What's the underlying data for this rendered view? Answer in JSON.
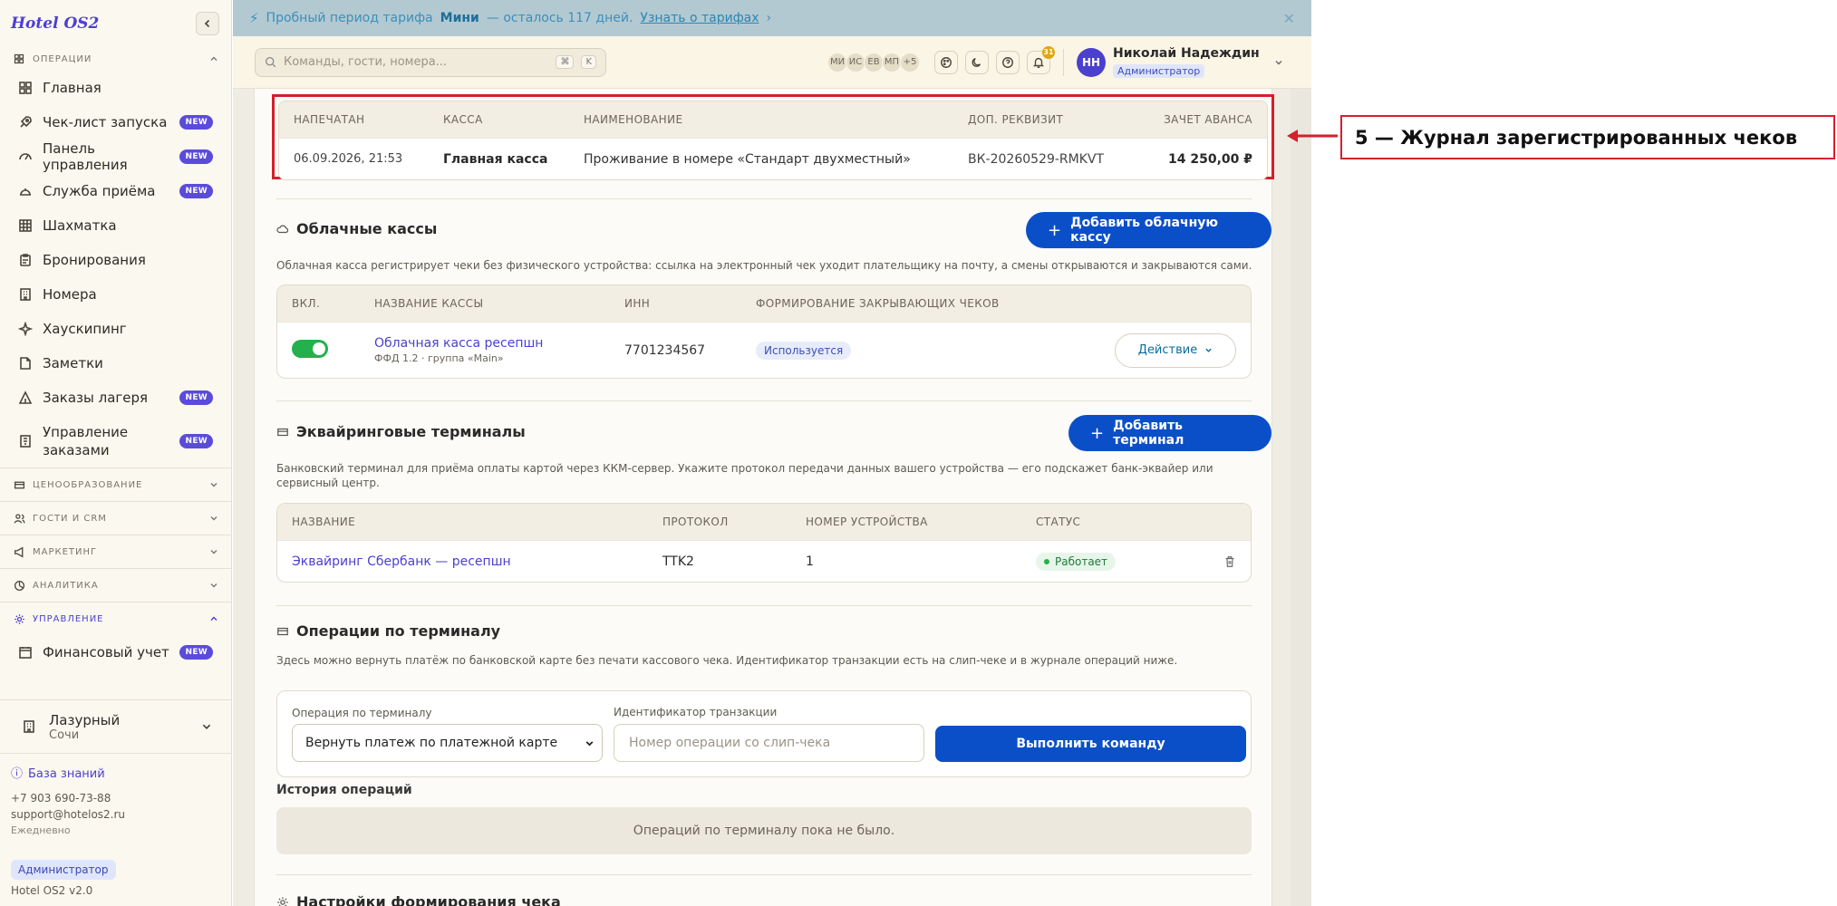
{
  "brand": "Hotel OS2",
  "sidebar": {
    "sections": [
      {
        "label": "Операции",
        "icon": "grid-icon",
        "expanded": true
      },
      {
        "label": "Ценообразование",
        "icon": "credit-card-icon"
      },
      {
        "label": "Гости и CRM",
        "icon": "users-icon"
      },
      {
        "label": "Маркетинг",
        "icon": "megaphone-icon"
      },
      {
        "label": "Аналитика",
        "icon": "chart-icon"
      },
      {
        "label": "Управление",
        "icon": "gear-icon",
        "expanded": true
      }
    ],
    "items": [
      {
        "label": "Главная",
        "icon": "home-icon",
        "new": false
      },
      {
        "label": "Чек-лист запуска",
        "icon": "rocket-icon",
        "new": true
      },
      {
        "label": "Панель управления",
        "icon": "gauge-icon",
        "new": true
      },
      {
        "label": "Служба приёма",
        "icon": "bell-desk-icon",
        "new": true
      },
      {
        "label": "Шахматка",
        "icon": "table-grid-icon",
        "new": false
      },
      {
        "label": "Бронирования",
        "icon": "clipboard-icon",
        "new": false
      },
      {
        "label": "Номера",
        "icon": "building-icon",
        "new": false
      },
      {
        "label": "Хаускипинг",
        "icon": "sparkle-icon",
        "new": false
      },
      {
        "label": "Заметки",
        "icon": "note-icon",
        "new": false
      },
      {
        "label": "Заказы лагеря",
        "icon": "tent-icon",
        "new": true
      },
      {
        "label": "Управление заказами",
        "icon": "receipt-icon",
        "new": true
      }
    ],
    "mgmt_items": [
      {
        "label": "Финансовый учет",
        "icon": "calendar-icon",
        "new": true
      }
    ],
    "new_badge": "NEW",
    "hotel": {
      "name": "Лазурный",
      "city": "Сочи"
    },
    "footer": {
      "kb": "База знаний",
      "phone": "+7 903 690-73-88",
      "email": "support@hotelos2.ru",
      "hours": "Ежедневно",
      "role": "Администратор",
      "version": "Hotel OS2 v2.0"
    }
  },
  "trial": {
    "pre": "Пробный период тарифа",
    "plan": "Мини",
    "post": "— осталось 117 дней.",
    "link": "Узнать о тарифах"
  },
  "topbar": {
    "search_placeholder": "Команды, гости, номера...",
    "kbd1": "⌘",
    "kbd2": "K",
    "avatars": [
      "МИ",
      "ИС",
      "ЕВ",
      "МП",
      "+5"
    ],
    "bell_count": "31",
    "user": {
      "initials": "НН",
      "name": "Николай Надеждин",
      "role": "Администратор"
    }
  },
  "receipts": {
    "headers": [
      "Напечатан",
      "Касса",
      "Наименование",
      "Доп. реквизит",
      "Зачет аванса"
    ],
    "rows": [
      {
        "printed": "06.09.2026, 21:53",
        "register": "Главная касса",
        "name": "Проживание в номере «Стандарт двухместный»",
        "extra": "ВК-20260529-RMKVT",
        "advance": "14 250,00 ₽"
      }
    ]
  },
  "cloud": {
    "title": "Облачные кассы",
    "add_button": "Добавить облачную кассу",
    "desc": "Облачная касса регистрирует чеки без физического устройства: ссылка на электронный чек уходит плательщику на почту, а смены открываются и закрываются сами.",
    "headers": [
      "Вкл.",
      "Название кассы",
      "ИНН",
      "Формирование закрывающих чеков"
    ],
    "rows": [
      {
        "name": "Облачная касса ресепшн",
        "sub": "ФФД 1.2 · группа «Main»",
        "inn": "7701234567",
        "status": "Используется",
        "action": "Действие"
      }
    ]
  },
  "terminals": {
    "title": "Эквайринговые терминалы",
    "add_button": "Добавить терминал",
    "desc": "Банковский терминал для приёма оплаты картой через ККМ-сервер. Укажите протокол передачи данных вашего устройства — его подскажет банк-эквайер или сервисный центр.",
    "headers": [
      "Название",
      "Протокол",
      "Номер устройства",
      "Статус"
    ],
    "rows": [
      {
        "name": "Эквайринг Сбербанк — ресепшн",
        "protocol": "TTK2",
        "device": "1",
        "status": "Работает"
      }
    ]
  },
  "operations": {
    "title": "Операции по терминалу",
    "desc": "Здесь можно вернуть платёж по банковской карте без печати кассового чека. Идентификатор транзакции есть на слип-чеке и в журнале операций ниже.",
    "op_label": "Операция по терминалу",
    "op_value": "Вернуть платеж по платежной карте",
    "tx_label": "Идентификатор транзакции",
    "tx_placeholder": "Номер операции со слип-чека",
    "exec_button": "Выполнить команду",
    "history_title": "История операций",
    "history_empty": "Операций по терминалу пока не было."
  },
  "receipt_settings": {
    "title": "Настройки формирования чека"
  },
  "annotation": {
    "text": "5 — Журнал зарегистрированных чеков",
    "color": "#d3202c"
  }
}
